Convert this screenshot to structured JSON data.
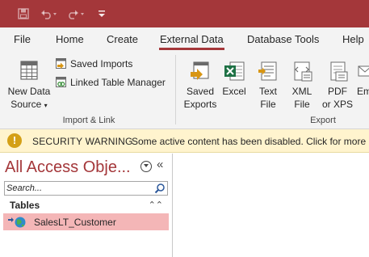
{
  "colors": {
    "accent": "#a4373a",
    "selected_item": "#f4b6b7",
    "warning_bar": "#fff4ce"
  },
  "quick_access": [
    "save-icon",
    "undo-icon",
    "redo-icon",
    "customize-qat-icon"
  ],
  "tabs": [
    "File",
    "Home",
    "Create",
    "External Data",
    "Database Tools",
    "Help"
  ],
  "active_tab": "External Data",
  "ribbon": {
    "import_link": {
      "new_data_source_line1": "New Data",
      "new_data_source_line2": "Source",
      "saved_imports": "Saved Imports",
      "linked_table_manager": "Linked Table Manager",
      "label": "Import & Link"
    },
    "export": {
      "saved_exports_line1": "Saved",
      "saved_exports_line2": "Exports",
      "excel": "Excel",
      "text_file_line1": "Text",
      "text_file_line2": "File",
      "xml_file_line1": "XML",
      "xml_file_line2": "File",
      "pdf_xps_line1": "PDF",
      "pdf_xps_line2": "or XPS",
      "email_partial": "Em",
      "label": "Export"
    }
  },
  "security_bar": {
    "title": "SECURITY WARNING",
    "message": "Some active content has been disabled. Click for more d"
  },
  "nav_pane": {
    "title": "All Access Obje...",
    "search_placeholder": "Search...",
    "group": "Tables",
    "items": [
      "SalesLT_Customer"
    ]
  }
}
